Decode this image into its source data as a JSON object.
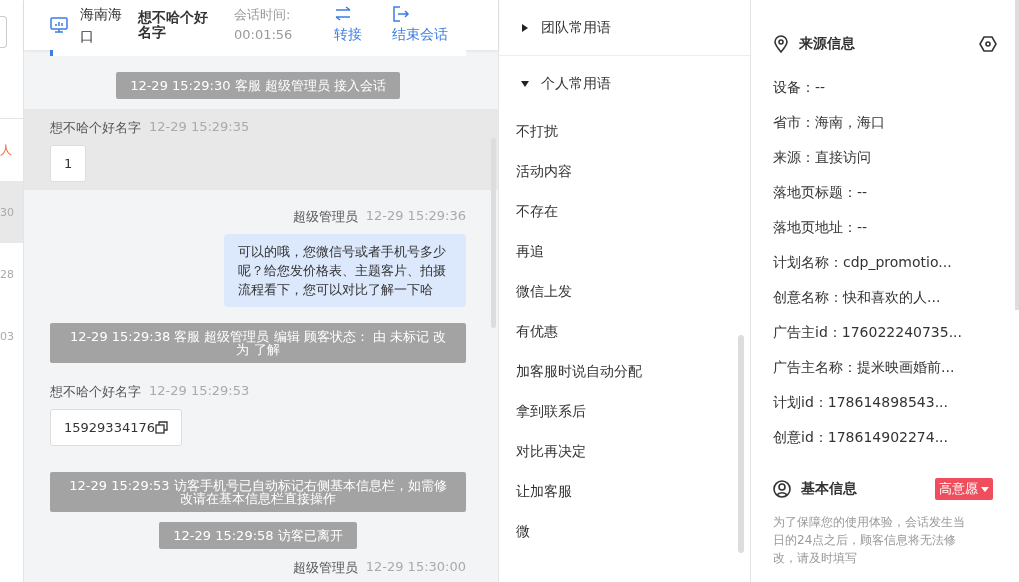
{
  "sidebar": {
    "items": [
      {
        "text": "人",
        "kind": "alert",
        "selected": false
      },
      {
        "text": "30",
        "kind": "time",
        "selected": true
      },
      {
        "text": "28",
        "kind": "time",
        "selected": false
      },
      {
        "text": "03",
        "kind": "time",
        "selected": false
      }
    ]
  },
  "header": {
    "location": "海南海口",
    "name": "想不哈个好名字",
    "session_label": "会话时间:",
    "session_time": "00:01:56",
    "actions": [
      {
        "label": "转接"
      },
      {
        "label": "结束会话"
      }
    ]
  },
  "messages": [
    {
      "kind": "system",
      "text": "12-29 15:29:30 客服 超级管理员 接入会话"
    },
    {
      "kind": "visitor",
      "sender": "想不哈个好名字",
      "time": "12-29 15:29:35",
      "text": "1",
      "highlighted": true,
      "copyable": false
    },
    {
      "kind": "agent",
      "sender": "超级管理员",
      "time": "12-29 15:29:36",
      "text": "可以的哦，您微信号或者手机号多少呢？给您发价格表、主题客片、拍摄流程看下，您可以对比了解一下哈"
    },
    {
      "kind": "system",
      "text": "12-29 15:29:38 客服 超级管理员 编辑 顾客状态： 由 未标记 改为 了解"
    },
    {
      "kind": "visitor",
      "sender": "想不哈个好名字",
      "time": "12-29 15:29:53",
      "text": "15929334176",
      "highlighted": false,
      "copyable": true
    },
    {
      "kind": "system",
      "text": "12-29 15:29:53 访客手机号已自动标记右侧基本信息栏，如需修改请在基本信息栏直接操作"
    },
    {
      "kind": "system",
      "text": "12-29 15:29:58 访客已离开"
    },
    {
      "kind": "agent",
      "sender": "超级管理员",
      "time": "12-29 15:30:00"
    }
  ],
  "phrases": [
    {
      "title": "团队常用语",
      "expanded": false
    },
    {
      "title": "个人常用语",
      "expanded": true,
      "items": [
        "不打扰",
        "活动内容",
        "不存在",
        "再追",
        "微信上发",
        "有优惠",
        "加客服时说自动分配",
        "拿到联系后",
        "对比再决定",
        "让加客服",
        "微"
      ]
    }
  ],
  "source_info": {
    "title": "来源信息",
    "fields": [
      "设备：--",
      "省市：海南，海口",
      "来源：直接访问",
      "落地页标题：--",
      "落地页地址：--",
      "计划名称：cdp_promotio...",
      "创意名称：快和喜欢的人...",
      "广告主id：176022240735...",
      "广告主名称：提米映画婚前...",
      "计划id：178614898543...",
      "创意id：178614902274..."
    ]
  },
  "basic_info": {
    "title": "基本信息",
    "tag": "高意愿",
    "note": "为了保障您的使用体验，会话发生当日的24点之后，顾客信息将无法修改，请及时填写"
  }
}
